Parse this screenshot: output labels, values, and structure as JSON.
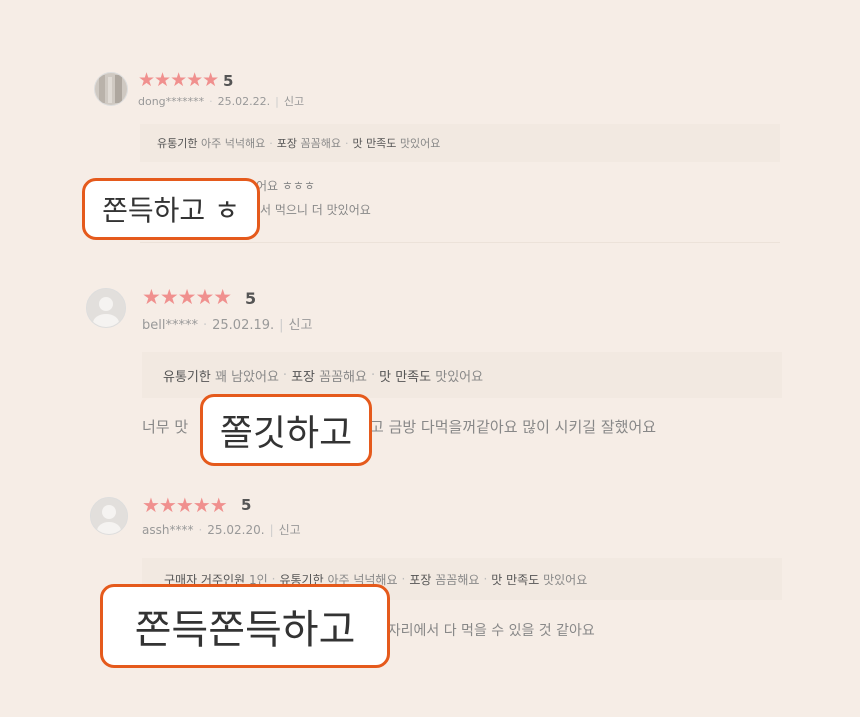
{
  "reviews": [
    {
      "stars": "★★★★★",
      "score": "5",
      "user": "dong*******",
      "date": "25.02.22.",
      "report": "신고",
      "tags": [
        {
          "k": "유통기한",
          "v": "아주 넉넉해요"
        },
        {
          "k": "포장",
          "v": "꼼꼼해요"
        },
        {
          "k": "맛",
          "v": ""
        },
        {
          "k": "만족도",
          "v": "맛있어요"
        }
      ],
      "line1": "어요 ㅎㅎㅎ",
      "line2": "서 먹으니 더 맛있어요"
    },
    {
      "stars": "★★★★★",
      "score": "5",
      "user": "bell*****",
      "date": "25.02.19.",
      "report": "신고",
      "tags": [
        {
          "k": "유통기한",
          "v": "꽤 남았어요"
        },
        {
          "k": "포장",
          "v": "꼼꼼해요"
        },
        {
          "k": "맛",
          "v": ""
        },
        {
          "k": "만족도",
          "v": "맛있어요"
        }
      ],
      "line_left": "너무 맛",
      "line_right": "고 금방 다먹을꺼같아요  많이 시키길 잘했어요"
    },
    {
      "stars": "★★★★★",
      "score": "5",
      "user": "assh****",
      "date": "25.02.20.",
      "report": "신고",
      "tags": [
        {
          "k": "구매자 거주인원",
          "v": "1인"
        },
        {
          "k": "유통기한",
          "v": "아주 넉넉해요"
        },
        {
          "k": "포장",
          "v": "꼼꼼해요"
        },
        {
          "k": "맛",
          "v": ""
        },
        {
          "k": "만족도",
          "v": "맛있어요"
        }
      ],
      "line_right": "앉은자리에서 다 먹을 수 있을 것 같아요"
    }
  ],
  "callouts": [
    "쫀득하고 ㅎ",
    "쫄깃하고",
    "쫀득쫀득하고"
  ],
  "colors": {
    "accent": "#e55a1c",
    "star": "#f0908e",
    "background": "#f6ede6"
  }
}
